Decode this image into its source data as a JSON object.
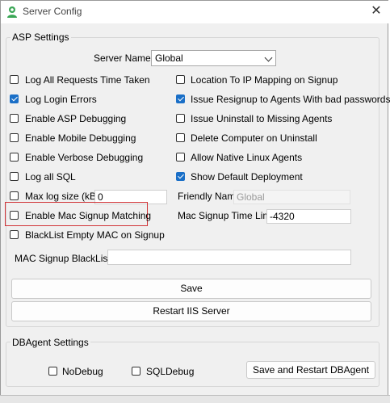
{
  "window": {
    "title": "Server Config",
    "close_icon": "close-icon"
  },
  "asp": {
    "group_label": "ASP Settings",
    "server_name_label": "Server Name",
    "server_name_value": "Global",
    "left_checks": [
      {
        "label": "Log All Requests Time Taken",
        "checked": false
      },
      {
        "label": "Log Login Errors",
        "checked": true
      },
      {
        "label": "Enable ASP Debugging",
        "checked": false
      },
      {
        "label": "Enable Mobile Debugging",
        "checked": false
      },
      {
        "label": "Enable Verbose Debugging",
        "checked": false
      },
      {
        "label": "Log all SQL",
        "checked": false
      },
      {
        "label": "Max log size (kB)",
        "checked": false
      },
      {
        "label": "Enable Mac Signup Matching",
        "checked": false
      },
      {
        "label": "BlackList Empty MAC on Signup",
        "checked": false
      }
    ],
    "right_checks": [
      {
        "label": "Location To IP Mapping on Signup",
        "checked": false
      },
      {
        "label": "Issue Resignup to Agents With bad passwords",
        "checked": true
      },
      {
        "label": "Issue Uninstall to Missing Agents",
        "checked": false
      },
      {
        "label": "Delete Computer on Uninstall",
        "checked": false
      },
      {
        "label": "Allow Native Linux Agents",
        "checked": false
      },
      {
        "label": "Show Default Deployment",
        "checked": true
      }
    ],
    "max_log_size_value": "0",
    "friendly_name_label": "Friendly Name",
    "friendly_name_value": "Global",
    "mac_signup_time_limit_label": "Mac Signup Time Limit",
    "mac_signup_time_limit_value": "-4320",
    "mac_signup_blacklist_label": "MAC Signup BlackList",
    "mac_signup_blacklist_value": "",
    "save_label": "Save",
    "restart_iis_label": "Restart IIS Server"
  },
  "dbagent": {
    "group_label": "DBAgent Settings",
    "nodebug_label": "NoDebug",
    "nodebug_checked": false,
    "sqldebug_label": "SQLDebug",
    "sqldebug_checked": false,
    "save_restart_label": "Save and Restart DBAgent"
  },
  "colors": {
    "accent": "#1a6fc7",
    "highlight": "#d13438"
  }
}
